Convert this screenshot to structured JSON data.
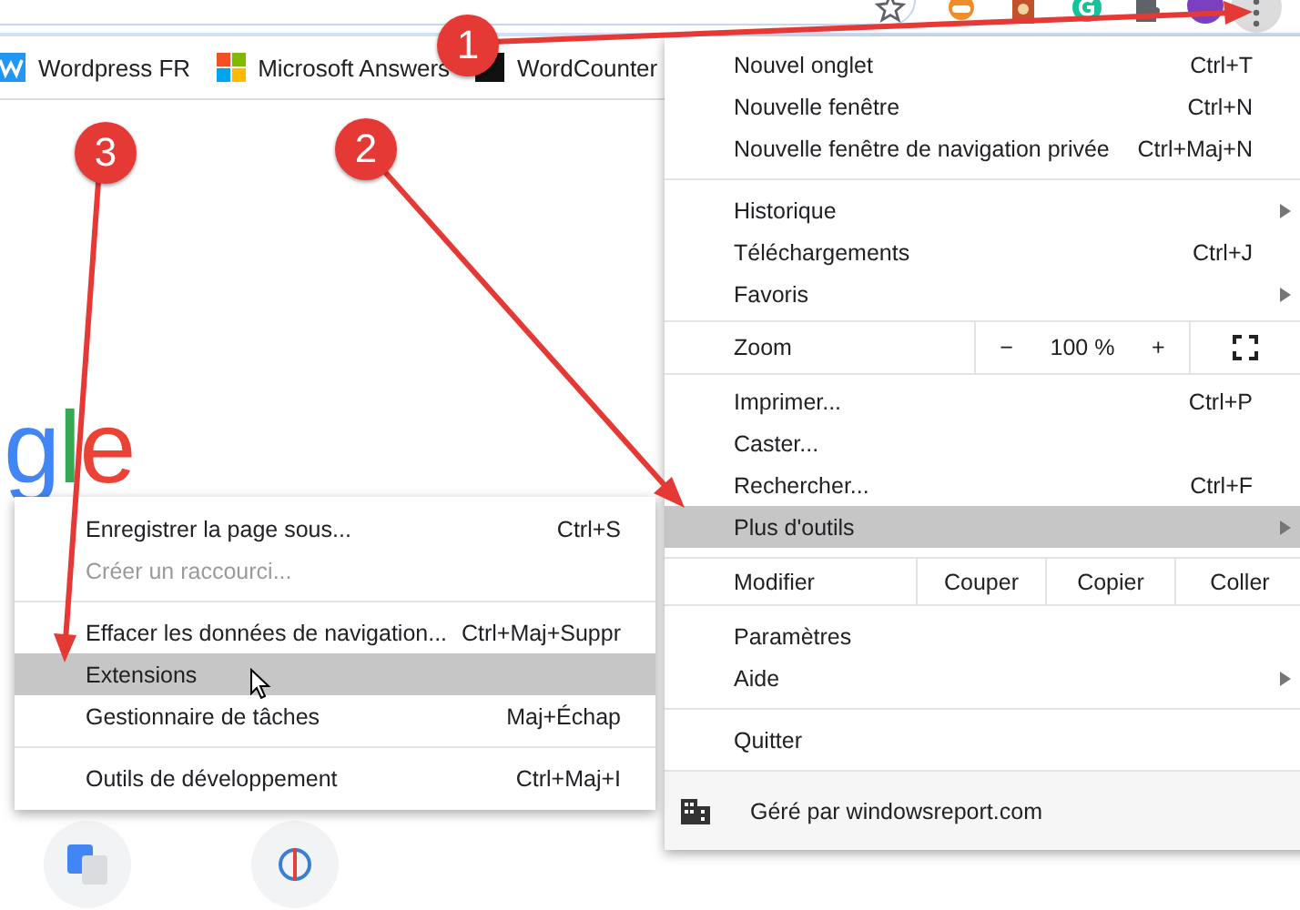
{
  "bookmarks": [
    {
      "label": "Wordpress FR",
      "kind": "w"
    },
    {
      "label": "Microsoft Answers",
      "kind": "windows"
    },
    {
      "label": "WordCounter",
      "kind": "square"
    }
  ],
  "page": {
    "logo": "gle"
  },
  "menu": {
    "items": [
      {
        "kind": "item",
        "label": "Nouvel onglet",
        "shortcut": "Ctrl+T",
        "submenu": false,
        "selected": false
      },
      {
        "kind": "item",
        "label": "Nouvelle fenêtre",
        "shortcut": "Ctrl+N",
        "submenu": false,
        "selected": false
      },
      {
        "kind": "item",
        "label": "Nouvelle fenêtre de navigation privée",
        "shortcut": "Ctrl+Maj+N",
        "submenu": false,
        "selected": false
      },
      {
        "kind": "separator"
      },
      {
        "kind": "item",
        "label": "Historique",
        "submenu": true,
        "selected": false
      },
      {
        "kind": "item",
        "label": "Téléchargements",
        "shortcut": "Ctrl+J",
        "submenu": false,
        "selected": false
      },
      {
        "kind": "item",
        "label": "Favoris",
        "submenu": true,
        "selected": false
      },
      {
        "kind": "zoom",
        "label": "Zoom",
        "minus": "−",
        "value": "100 %",
        "plus": "+"
      },
      {
        "kind": "item",
        "label": "Imprimer...",
        "shortcut": "Ctrl+P",
        "submenu": false,
        "selected": false
      },
      {
        "kind": "item",
        "label": "Caster...",
        "submenu": false,
        "selected": false
      },
      {
        "kind": "item",
        "label": "Rechercher...",
        "shortcut": "Ctrl+F",
        "submenu": false,
        "selected": false
      },
      {
        "kind": "item",
        "label": "Plus d'outils",
        "submenu": true,
        "selected": true
      },
      {
        "kind": "edit",
        "label": "Modifier",
        "actions": [
          "Couper",
          "Copier",
          "Coller"
        ]
      },
      {
        "kind": "item",
        "label": "Paramètres",
        "submenu": false,
        "selected": false
      },
      {
        "kind": "item",
        "label": "Aide",
        "submenu": true,
        "selected": false
      },
      {
        "kind": "separator"
      },
      {
        "kind": "item",
        "label": "Quitter",
        "submenu": false,
        "selected": false
      },
      {
        "kind": "managed",
        "label": "Géré par windowsreport.com"
      }
    ]
  },
  "submenu": {
    "items": [
      {
        "kind": "item",
        "label": "Enregistrer la page sous...",
        "shortcut": "Ctrl+S",
        "disabled": false,
        "selected": false
      },
      {
        "kind": "item",
        "label": "Créer un raccourci...",
        "disabled": true,
        "selected": false
      },
      {
        "kind": "separator"
      },
      {
        "kind": "item",
        "label": "Effacer les données de navigation...",
        "shortcut": "Ctrl+Maj+Suppr",
        "disabled": false,
        "selected": false
      },
      {
        "kind": "item",
        "label": "Extensions",
        "disabled": false,
        "selected": true
      },
      {
        "kind": "item",
        "label": "Gestionnaire de tâches",
        "shortcut": "Maj+Échap",
        "disabled": false,
        "selected": false
      },
      {
        "kind": "separator"
      },
      {
        "kind": "item",
        "label": "Outils de développement",
        "shortcut": "Ctrl+Maj+I",
        "disabled": false,
        "selected": false
      }
    ]
  },
  "annotations": [
    {
      "label": "1"
    },
    {
      "label": "2"
    },
    {
      "label": "3"
    }
  ]
}
